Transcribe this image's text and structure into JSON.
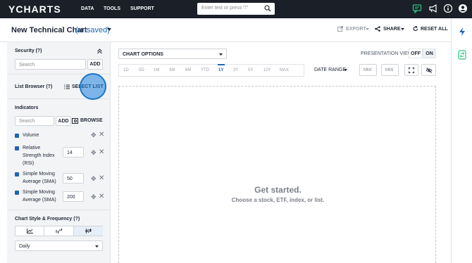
{
  "topbar": {
    "logo": "YCHARTS",
    "nav": [
      "DATA",
      "TOOLS",
      "SUPPORT"
    ],
    "search_placeholder": "Enter text or press \"/\"",
    "icons": [
      "chat-icon",
      "megaphone-icon",
      "info-icon",
      "user-icon"
    ]
  },
  "header": {
    "title": "New Technical Chart",
    "unsaved": "(unsaved)",
    "export_label": "EXPORT",
    "share_label": "SHARE",
    "reset_label": "RESET ALL"
  },
  "sidebar": {
    "security": {
      "label": "Security (?)",
      "search_placeholder": "Search",
      "add_label": "ADD"
    },
    "list_browser": {
      "label": "List Browser (?)",
      "button_label": "SELECT LIST"
    },
    "indicators": {
      "label": "Indicators",
      "search_placeholder": "Search",
      "add_label": "ADD",
      "browse_label": "BROWSE",
      "items": [
        {
          "name": "Volume",
          "value": ""
        },
        {
          "name": "Relative Strength Index (RSI)",
          "line1": "Relative",
          "line2": "Strength Index",
          "line3": "(RSI)",
          "value": "14"
        },
        {
          "name": "Simple Moving Average (SMA)",
          "line1": "Simple Moving",
          "line2": "Average (SMA)",
          "value": "50"
        },
        {
          "name": "Simple Moving Average (SMA)",
          "line1": "Simple Moving",
          "line2": "Average (SMA)",
          "value": "200"
        }
      ]
    },
    "chart_style": {
      "label": "Chart Style & Frequency (?)",
      "frequency": "Daily"
    }
  },
  "main": {
    "chart_options_label": "CHART OPTIONS",
    "presentation_view_label": "PRESENTATION VIEW",
    "off_label": "OFF",
    "on_label": "ON",
    "timeframes": [
      "1D",
      "5D",
      "1M",
      "3M",
      "6M",
      "YTD",
      "1Y",
      "3Y",
      "5Y",
      "10Y",
      "MAX"
    ],
    "active_timeframe": "1Y",
    "date_range_label": "DATE RANGE",
    "date_placeholder": "MM/",
    "empty_title": "Get started.",
    "empty_subtitle": "Choose a stock, ETF, index, or list."
  },
  "colors": {
    "accent": "#1e64b4",
    "topbar": "#1b1f27",
    "sidebar": "#f3f4f6",
    "highlight": "#1a76c9"
  }
}
